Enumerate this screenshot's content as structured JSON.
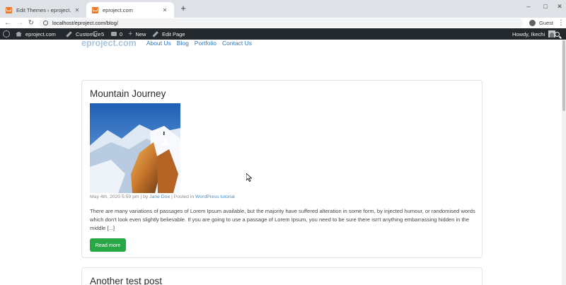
{
  "browser": {
    "tabs": [
      {
        "title": "Edit Themes ‹ eproject.com — W",
        "close": "✕"
      },
      {
        "title": "eproject.com",
        "close": "✕"
      }
    ],
    "new_tab": "+",
    "url": "localhost/eproject.com/blog/",
    "profile": "Guest",
    "window_controls": {
      "minimize": "–",
      "maximize": "□",
      "close": "✕"
    },
    "nav": {
      "back": "←",
      "forward": "→",
      "reload": "↻"
    },
    "menu": "⋮"
  },
  "admin_bar": {
    "site": "eproject.com",
    "customize": "Customize",
    "updates_count": "5",
    "comments_count": "0",
    "new": "New",
    "edit_page": "Edit Page",
    "greeting": "Howdy, Ikechi"
  },
  "site_nav": {
    "brand": "eproject.com",
    "links": [
      "About Us",
      "Blog",
      "Portfolio",
      "Contact Us"
    ]
  },
  "posts": [
    {
      "title": "Mountain Journey",
      "date": "May 4th, 2020 5:59 pm",
      "by": " | by ",
      "author": "Jane Doe",
      "posted_in": " | Posted in ",
      "category": "WordPress tutorial",
      "excerpt": "There are many variations of passages of Lorem Ipsum available, but the majority have suffered alteration in some form, by injected humour, or randomised words which don't look even slightly believable. If you are going to use a passage of Lorem Ipsum, you need to be sure there isn't anything embarrassing hidden in the middle [...]",
      "read_more": "Read more"
    },
    {
      "title": "Another test post"
    }
  ],
  "colors": {
    "admin_bar_bg": "#23282d",
    "link": "#3f8ed6",
    "button_green": "#28a745",
    "brand_faded": "#a8c4dc"
  }
}
